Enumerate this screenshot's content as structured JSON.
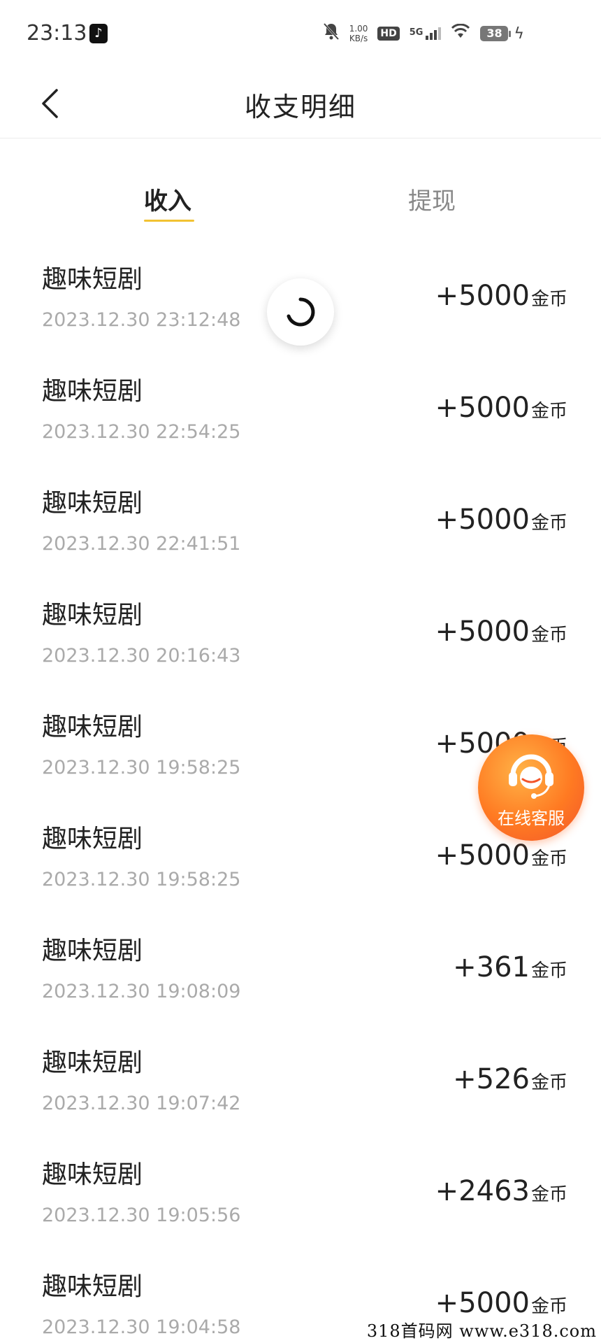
{
  "status_bar": {
    "time": "23:13",
    "net_speed_value": "1.00",
    "net_speed_unit": "KB/s",
    "hd": "HD",
    "network": "5G",
    "battery": "38",
    "icons": [
      "tiktok-icon",
      "mute-bell-icon",
      "signal-icon",
      "wifi-icon",
      "battery-icon",
      "charging-icon"
    ]
  },
  "header": {
    "title": "收支明细"
  },
  "tabs": {
    "income": "收入",
    "withdraw": "提现",
    "active": "income",
    "accent_color": "#f2c232"
  },
  "records": [
    {
      "title": "趣味短剧",
      "time": "2023.12.30 23:12:48",
      "amount": "+5000",
      "unit": "金币"
    },
    {
      "title": "趣味短剧",
      "time": "2023.12.30 22:54:25",
      "amount": "+5000",
      "unit": "金币"
    },
    {
      "title": "趣味短剧",
      "time": "2023.12.30 22:41:51",
      "amount": "+5000",
      "unit": "金币"
    },
    {
      "title": "趣味短剧",
      "time": "2023.12.30 20:16:43",
      "amount": "+5000",
      "unit": "金币"
    },
    {
      "title": "趣味短剧",
      "time": "2023.12.30 19:58:25",
      "amount": "+5000",
      "unit": "金币"
    },
    {
      "title": "趣味短剧",
      "time": "2023.12.30 19:58:25",
      "amount": "+5000",
      "unit": "金币"
    },
    {
      "title": "趣味短剧",
      "time": "2023.12.30 19:08:09",
      "amount": "+361",
      "unit": "金币"
    },
    {
      "title": "趣味短剧",
      "time": "2023.12.30 19:07:42",
      "amount": "+526",
      "unit": "金币"
    },
    {
      "title": "趣味短剧",
      "time": "2023.12.30 19:05:56",
      "amount": "+2463",
      "unit": "金币"
    },
    {
      "title": "趣味短剧",
      "time": "2023.12.30 19:04:58",
      "amount": "+5000",
      "unit": "金币"
    }
  ],
  "online_service": {
    "label": "在线客服",
    "icon": "customer-service-headset-icon"
  },
  "watermark": "318首码网  www.e318.com"
}
